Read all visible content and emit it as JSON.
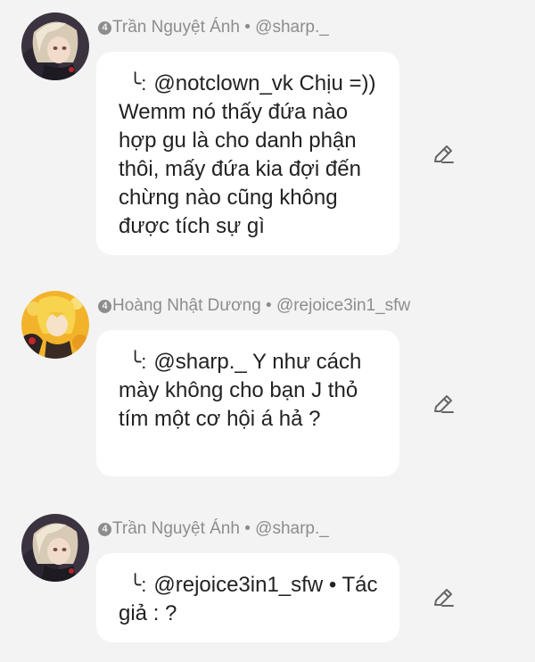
{
  "comments": [
    {
      "rank": "4",
      "author": "Trần Nguyệt Ánh",
      "separator": "•",
      "handle": "@sharp._",
      "reply_mark": "╰:",
      "text": "@notclown_vk Chịu =)) Wemm nó thấy đứa nào hợp gu là cho danh phận thôi, mấy đứa kia đợi đến chừng nào cũng không được tích sự gì"
    },
    {
      "rank": "4",
      "author": "Hoàng Nhật Dương",
      "separator": "•",
      "handle": "@rejoice3in1_sfw",
      "reply_mark": "╰:",
      "text": "@sharp._ Y như cách mày không cho bạn J thỏ tím một cơ hội á hả ?"
    },
    {
      "rank": "4",
      "author": "Trần Nguyệt Ánh",
      "separator": "•",
      "handle": "@sharp._",
      "reply_mark": "╰:",
      "text": "@rejoice3in1_sfw • Tác giả : ?"
    }
  ],
  "icons": {
    "edit": "pencil-icon",
    "rank": "number-badge-icon"
  },
  "colors": {
    "background": "#f3f3f3",
    "bubble": "#ffffff",
    "meta_text": "#8d8d8d",
    "body_text": "#222222"
  }
}
